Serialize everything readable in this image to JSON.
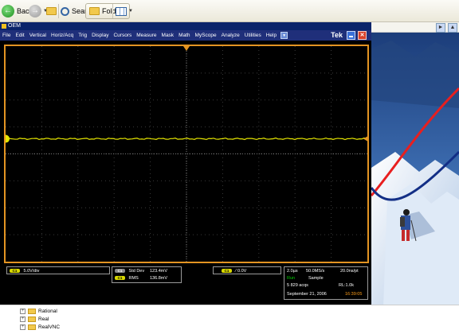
{
  "explorer": {
    "back_label": "Back",
    "search_label": "Search",
    "folders_label": "Folders",
    "tree_items": [
      "Rational",
      "Real",
      "RealVNC"
    ]
  },
  "scope": {
    "title": "OEM",
    "brand": "Tek",
    "menu": [
      "File",
      "Edit",
      "Vertical",
      "Horiz/Acq",
      "Trig",
      "Display",
      "Cursors",
      "Measure",
      "Mask",
      "Math",
      "MyScope",
      "Analyze",
      "Utilities",
      "Help"
    ],
    "channel": {
      "label": "C1",
      "scale": "5.0V/div"
    },
    "measurements": [
      {
        "badge": "C1",
        "name": "Std Dev",
        "value": "123.4mV"
      },
      {
        "badge": "C1",
        "name": "RMS",
        "value": "136.8mV"
      }
    ],
    "trigger": {
      "label": "C1",
      "level": "0.0V"
    },
    "acquisition": {
      "timebase": "2.0µs",
      "sample_rate": "50.0MS/s",
      "resolution": "20.0ns/pt",
      "state": "Run",
      "mode": "Sample",
      "acqs": "5 829 acqs",
      "record_length": "RL:1.0k",
      "date": "September 21, 2006",
      "time": "16:39:05"
    },
    "colors": {
      "trace": "#e6e600",
      "frame": "#e39422",
      "run": "#00d000",
      "time": "#ff9f1a"
    }
  },
  "icons": [
    "back-icon",
    "forward-icon",
    "up-folder-icon",
    "search-icon",
    "folders-icon",
    "views-icon",
    "minimize-icon",
    "close-icon"
  ]
}
